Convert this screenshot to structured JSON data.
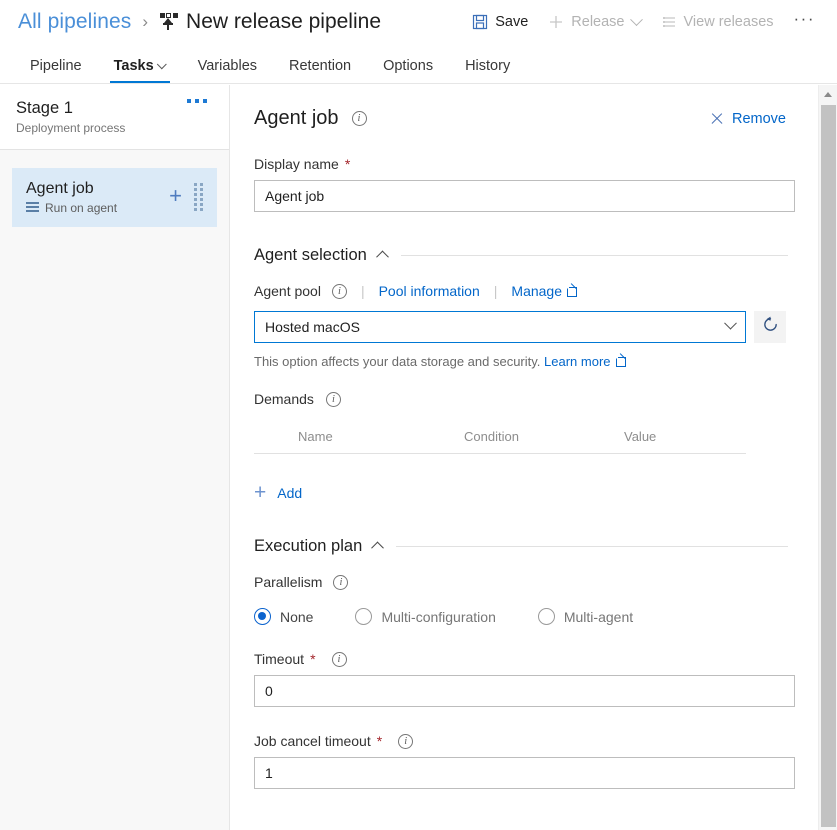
{
  "header": {
    "breadcrumb_link": "All pipelines",
    "breadcrumb_separator": "›",
    "pipeline_icon": "release-pipeline-icon",
    "title": "New release pipeline",
    "actions": {
      "save": "Save",
      "release": "Release",
      "view_releases": "View releases",
      "more": "···"
    }
  },
  "tabs": [
    {
      "label": "Pipeline",
      "active": false,
      "has_chevron": false
    },
    {
      "label": "Tasks",
      "active": true,
      "has_chevron": true
    },
    {
      "label": "Variables",
      "active": false,
      "has_chevron": false
    },
    {
      "label": "Retention",
      "active": false,
      "has_chevron": false
    },
    {
      "label": "Options",
      "active": false,
      "has_chevron": false
    },
    {
      "label": "History",
      "active": false,
      "has_chevron": false
    }
  ],
  "sidebar": {
    "stage": {
      "title": "Stage 1",
      "subtitle": "Deployment process",
      "menu_icon": "ellipsis-icon"
    },
    "jobs": [
      {
        "title": "Agent job",
        "subtitle": "Run on agent",
        "selected": true,
        "add_icon": "plus-icon",
        "drag_icon": "drag-handle-icon"
      }
    ]
  },
  "main": {
    "panel_title": "Agent job",
    "remove_label": "Remove",
    "display_name": {
      "label": "Display name",
      "required": "*",
      "value": "Agent job"
    },
    "agent_selection": {
      "section_title": "Agent selection",
      "agent_pool_label": "Agent pool",
      "pool_information_link": "Pool information",
      "manage_link": "Manage",
      "separator": "|",
      "selected_pool": "Hosted macOS",
      "refresh_icon": "refresh-icon",
      "note_text": "This option affects your data storage and security.",
      "note_link": "Learn more"
    },
    "demands": {
      "label": "Demands",
      "columns": [
        "Name",
        "Condition",
        "Value"
      ],
      "rows": [],
      "add_label": "Add"
    },
    "execution_plan": {
      "section_title": "Execution plan",
      "parallelism_label": "Parallelism",
      "options": [
        {
          "label": "None",
          "selected": true
        },
        {
          "label": "Multi-configuration",
          "selected": false
        },
        {
          "label": "Multi-agent",
          "selected": false
        }
      ],
      "timeout": {
        "label": "Timeout",
        "required": "*",
        "value": "0"
      },
      "job_cancel_timeout": {
        "label": "Job cancel timeout",
        "required": "*",
        "value": "1"
      }
    }
  },
  "colors": {
    "accent": "#0078d4",
    "link": "#0366c9",
    "selected_row": "#dbeaf7",
    "required_marker": "#a4262c"
  }
}
